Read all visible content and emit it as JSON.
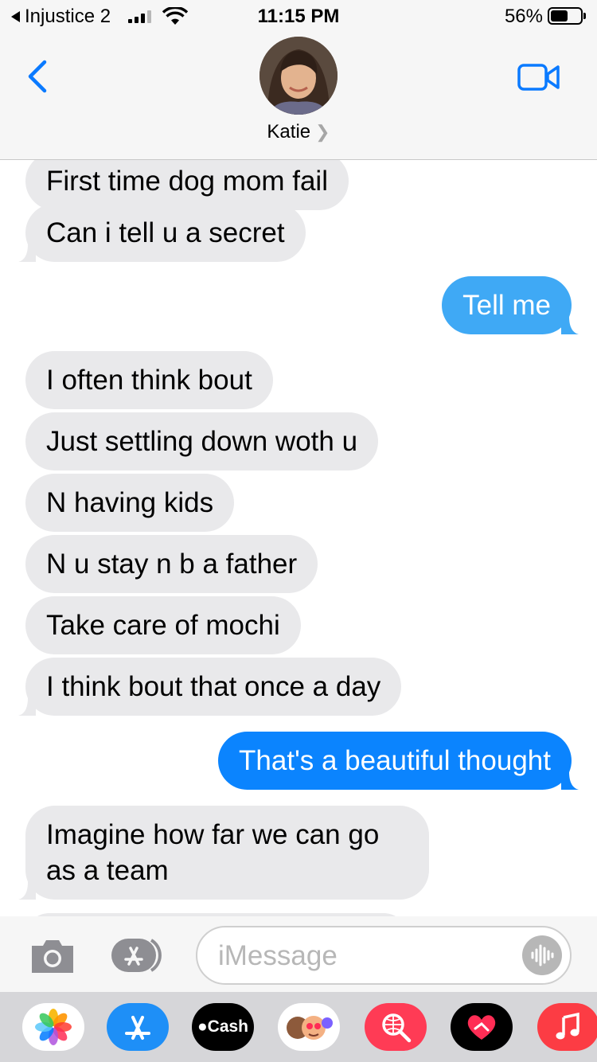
{
  "status_bar": {
    "back_app": "Injustice 2",
    "time": "11:15 PM",
    "battery_percent": "56%",
    "battery_level": 0.56,
    "signal_bars": 3
  },
  "header": {
    "contact_name": "Katie",
    "back_icon": "chevron-left-icon",
    "video_icon": "facetime-video-icon"
  },
  "messages": [
    {
      "direction": "incoming",
      "text": "First time dog mom fail"
    },
    {
      "direction": "incoming",
      "text": "Can i tell u a secret"
    },
    {
      "direction": "outgoing",
      "service": "sms",
      "text": "Tell me"
    },
    {
      "direction": "incoming",
      "text": "I often think bout"
    },
    {
      "direction": "incoming",
      "text": "Just settling down woth u"
    },
    {
      "direction": "incoming",
      "text": "N having kids"
    },
    {
      "direction": "incoming",
      "text": "N u stay n b a father"
    },
    {
      "direction": "incoming",
      "text": "Take care of mochi"
    },
    {
      "direction": "incoming",
      "text": "I think bout that once a day"
    },
    {
      "direction": "outgoing",
      "service": "imessage",
      "text": "That's a beautiful thought"
    },
    {
      "direction": "incoming",
      "line1": "Imagine how far we can go",
      "line2": "as a team"
    }
  ],
  "input_bar": {
    "placeholder": "iMessage",
    "camera_icon": "camera-icon",
    "apps_icon": "app-store-icon",
    "audio_icon": "audio-waveform-icon"
  },
  "app_drawer": {
    "apps": [
      {
        "name": "photos-icon"
      },
      {
        "name": "app-store-icon"
      },
      {
        "name": "apple-cash-icon",
        "label": "Cash"
      },
      {
        "name": "memoji-icon"
      },
      {
        "name": "search-images-icon"
      },
      {
        "name": "digital-touch-icon"
      },
      {
        "name": "music-icon"
      }
    ]
  },
  "colors": {
    "incoming_bubble": "#e9e9eb",
    "sms_bubble": "#3fa9f5",
    "imessage_bubble": "#0b84fe",
    "accent_blue": "#0a7aff"
  }
}
